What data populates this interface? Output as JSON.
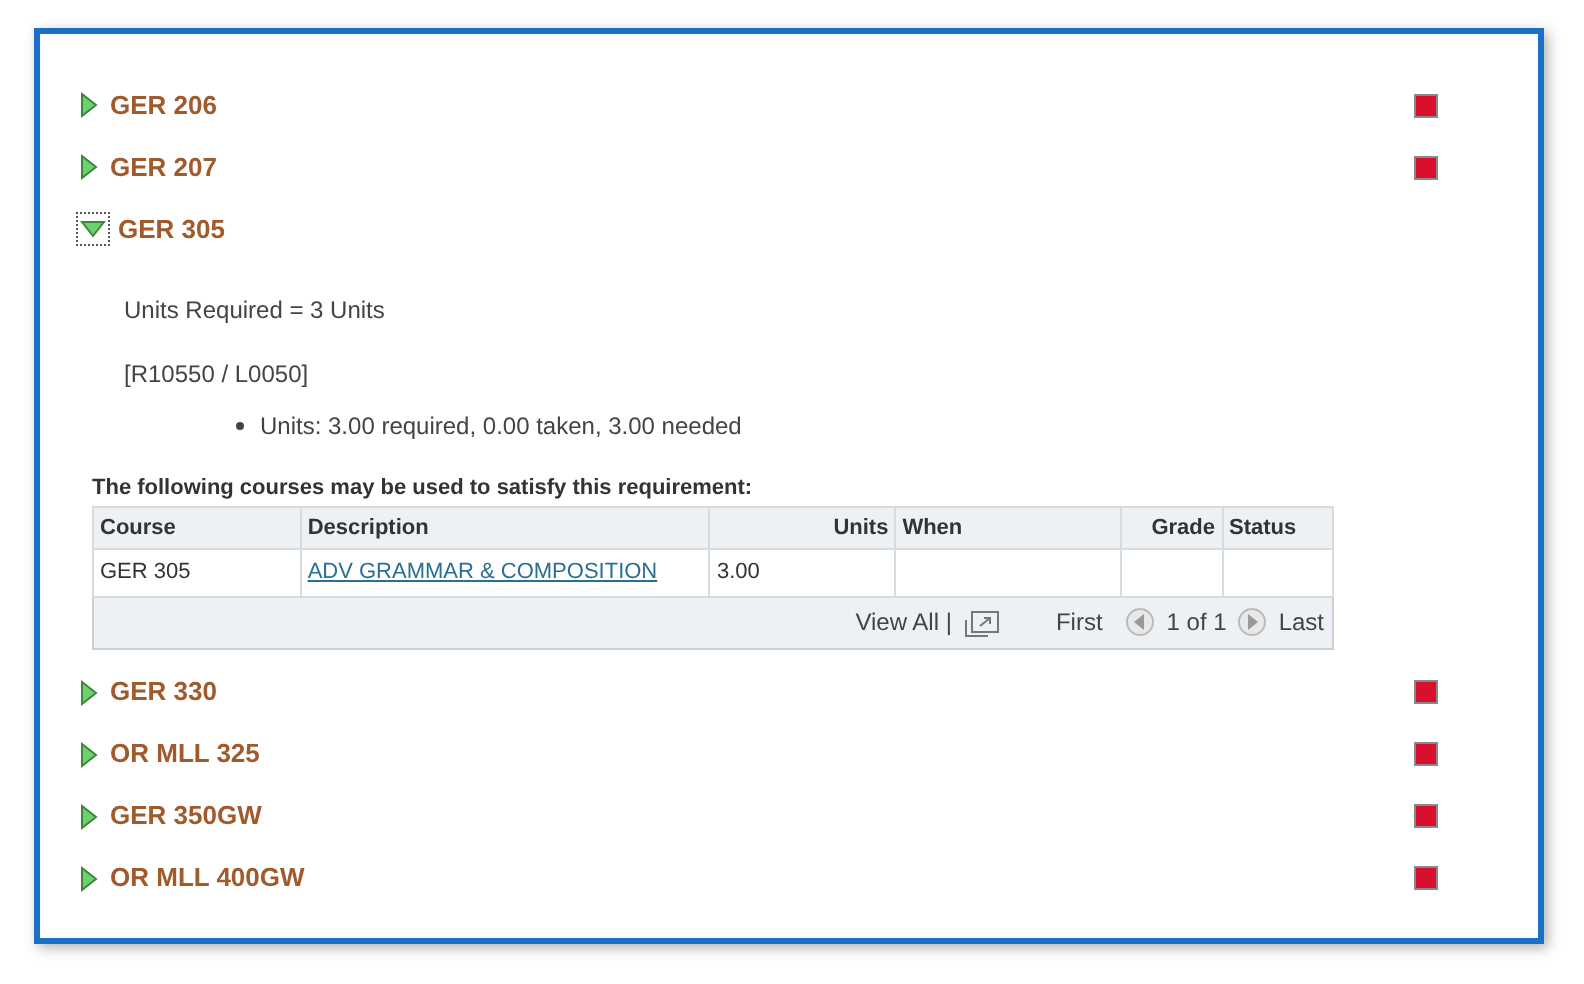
{
  "requirements": [
    {
      "title": "GER 206",
      "expanded": false,
      "flagged": true
    },
    {
      "title": "GER 207",
      "expanded": false,
      "flagged": true
    },
    {
      "title": "GER 305",
      "expanded": true,
      "flagged": false,
      "detail": {
        "units_required": "Units Required = 3 Units",
        "rule": "[R10550 / L0050]",
        "bullets": [
          "Units: 3.00 required, 0.00 taken, 3.00 needed"
        ],
        "caption": "The following courses may be used to satisfy this requirement:",
        "columns": [
          "Course",
          "Description",
          "Units",
          "When",
          "Grade",
          "Status"
        ],
        "rows": [
          [
            "GER 305",
            "ADV GRAMMAR & COMPOSITION",
            "3.00",
            "",
            "",
            ""
          ]
        ],
        "footer": {
          "view_all": "View All |",
          "first": "First",
          "page": "1 of 1",
          "last": "Last"
        }
      }
    },
    {
      "title": "GER 330",
      "expanded": false,
      "flagged": true
    },
    {
      "title": "OR MLL 325",
      "expanded": false,
      "flagged": true
    },
    {
      "title": "GER 350GW",
      "expanded": false,
      "flagged": true
    },
    {
      "title": "OR MLL 400GW",
      "expanded": false,
      "flagged": true
    }
  ]
}
